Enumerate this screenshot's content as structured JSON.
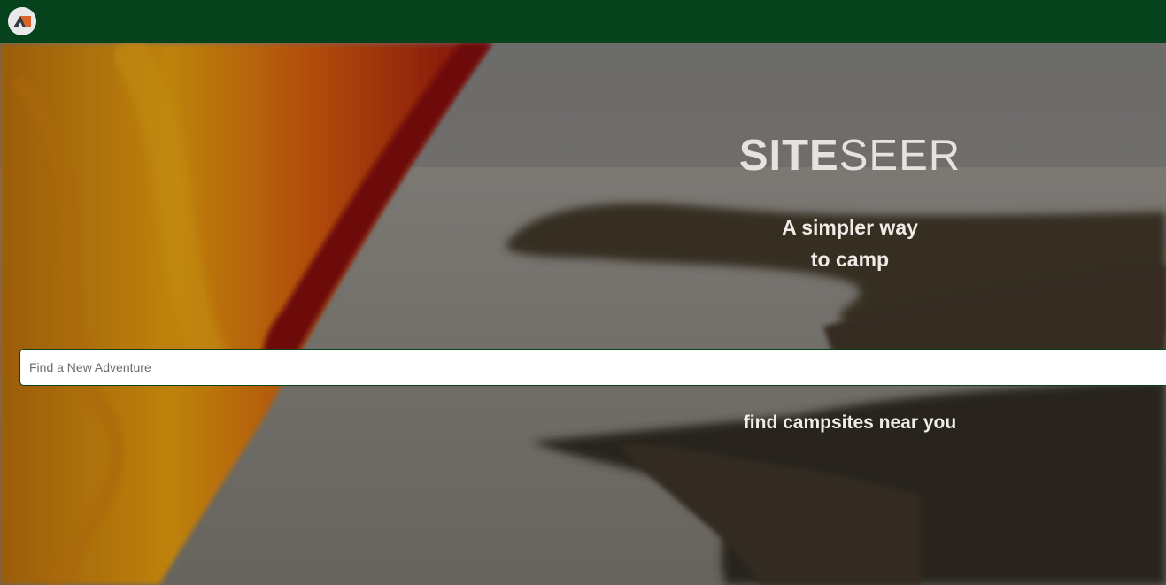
{
  "navbar": {
    "logo_icon": "tent-icon",
    "background_color": "#06421c"
  },
  "hero": {
    "brand_bold": "SITE",
    "brand_light": "SEER",
    "tagline_line1": "A simpler way",
    "tagline_line2": "to camp",
    "search_placeholder": "Find a New Adventure",
    "cta_text": "find campsites near you"
  }
}
